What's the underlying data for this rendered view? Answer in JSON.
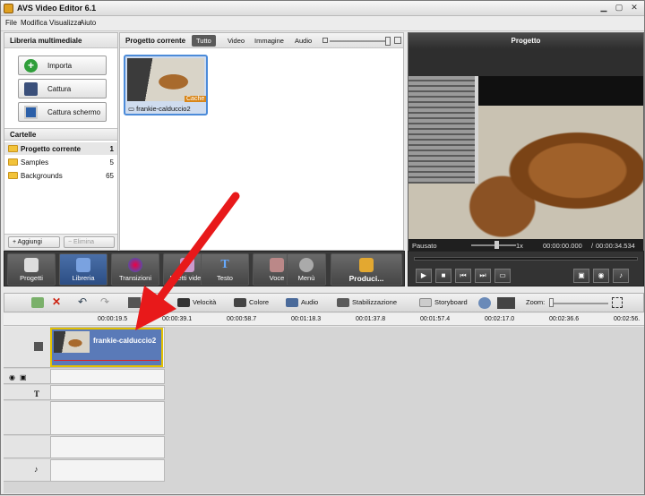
{
  "window": {
    "title": "AVS Video Editor 6.1"
  },
  "menu": [
    "File",
    "Modifica",
    "Visualizza",
    "Aiuto"
  ],
  "library": {
    "header": "Libreria multimediale",
    "buttons": [
      "Importa",
      "Cattura",
      "Cattura schermo"
    ],
    "folders_header": "Cartelle",
    "folders": [
      {
        "name": "Progetto corrente",
        "count": "1"
      },
      {
        "name": "Samples",
        "count": "5"
      },
      {
        "name": "Backgrounds",
        "count": "65"
      }
    ],
    "add_label": "Aggiungi",
    "remove_label": "Elimina"
  },
  "media": {
    "header": "Progetto corrente",
    "filters": [
      "Tutto",
      "Video",
      "Immagine",
      "Audio"
    ],
    "active_filter": "Tutto",
    "items": [
      {
        "name": "frankie-calduccio2",
        "badge": "Cache"
      }
    ]
  },
  "preview": {
    "header": "Progetto",
    "status": "Pausato",
    "speed": "1x",
    "time_current": "00:00:00.000",
    "time_total": "00:00:34.534"
  },
  "toolbar": {
    "buttons": [
      {
        "label": "Progetti",
        "icon": "clapper-icon"
      },
      {
        "label": "Libreria",
        "icon": "library-icon"
      },
      {
        "label": "Transizioni",
        "icon": "transitions-icon"
      },
      {
        "label": "Effetti video",
        "icon": "effects-icon"
      },
      {
        "label": "Testo",
        "icon": "text-icon"
      },
      {
        "label": "Voce",
        "icon": "microphone-icon"
      },
      {
        "label": "Menù",
        "icon": "menu-icon"
      },
      {
        "label": "Produci...",
        "icon": "produce-icon"
      }
    ],
    "active": "Libreria"
  },
  "timeline": {
    "tools": [
      "Velocità",
      "Colore",
      "Audio",
      "Stabilizzazione",
      "Storyboard",
      "Zoom:"
    ],
    "ruler": [
      "00:00:19.5",
      "00:00:39.1",
      "00:00:58.7",
      "00:01:18.3",
      "00:01:37.8",
      "00:01:57.4",
      "00:02:17.0",
      "00:02:36.6",
      "00:02:56."
    ],
    "clip_name": "frankie-calduccio2"
  },
  "colors": {
    "accent": "#4c8bd9",
    "arrow": "#e8191a",
    "clip_border": "#e2c000"
  }
}
